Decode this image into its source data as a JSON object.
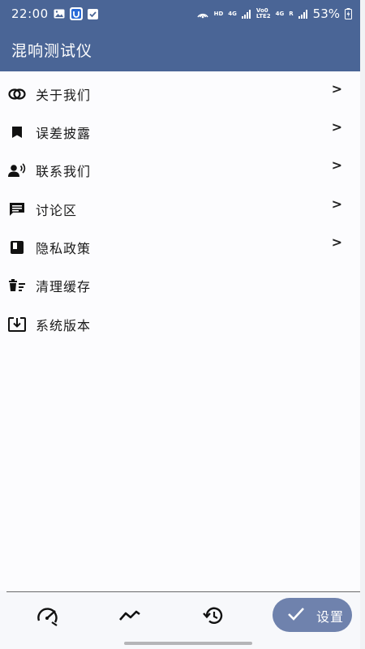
{
  "status_bar": {
    "time": "22:00",
    "network_hd": "HD",
    "network_4g_1": "4G",
    "network_volte": "Vo0",
    "network_lte2": "LTE2",
    "network_4g_2": "4G",
    "network_r": "R",
    "battery": "53%"
  },
  "app_bar": {
    "title": "混响测试仪"
  },
  "menu": {
    "items": [
      {
        "label": "关于我们",
        "icon": "rings-icon",
        "has_chevron": true
      },
      {
        "label": "误差披露",
        "icon": "bookmark-icon",
        "has_chevron": true
      },
      {
        "label": "联系我们",
        "icon": "contact-voice-icon",
        "has_chevron": true
      },
      {
        "label": "讨论区",
        "icon": "message-icon",
        "has_chevron": true
      },
      {
        "label": "隐私政策",
        "icon": "book-icon",
        "has_chevron": true
      },
      {
        "label": "清理缓存",
        "icon": "clear-cache-icon",
        "has_chevron": false
      },
      {
        "label": "系统版本",
        "icon": "download-box-icon",
        "has_chevron": false
      }
    ],
    "chevron_glyph": ">"
  },
  "bottom_nav": {
    "items": [
      {
        "icon": "gauge-icon"
      },
      {
        "icon": "trend-icon"
      },
      {
        "icon": "history-icon"
      }
    ],
    "fab_label": "设置"
  },
  "colors": {
    "primary": "#4a6596",
    "fab": "#6f82ad",
    "background": "#fcfcfe"
  }
}
